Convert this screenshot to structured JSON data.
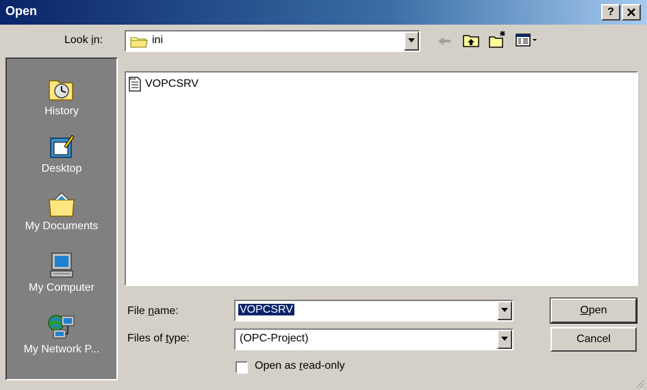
{
  "window": {
    "title": "Open",
    "help_btn": "?",
    "close_btn": "x"
  },
  "lookin": {
    "label_pre": "Look ",
    "label_ul": "i",
    "label_post": "n:",
    "value": "ini",
    "icon": "folder-icon"
  },
  "toolbar": {
    "back_icon": "back-arrow-icon",
    "up_icon": "up-folder-icon",
    "newfolder_icon": "new-folder-icon",
    "views_icon": "views-menu-icon"
  },
  "places": [
    {
      "label": "History",
      "icon": "history-icon"
    },
    {
      "label": "Desktop",
      "icon": "desktop-icon"
    },
    {
      "label": "My Documents",
      "icon": "my-documents-icon"
    },
    {
      "label": "My Computer",
      "icon": "my-computer-icon"
    },
    {
      "label": "My Network P...",
      "icon": "my-network-places-icon"
    }
  ],
  "files": [
    {
      "name": "VOPCSRV",
      "icon": "ini-file-icon"
    }
  ],
  "filename": {
    "label_pre": "File ",
    "label_ul": "n",
    "label_post": "ame:",
    "value": "VOPCSRV"
  },
  "filetype": {
    "label_pre": "Files of ",
    "label_ul": "t",
    "label_post": "ype:",
    "value": "(OPC-Project)"
  },
  "readonly": {
    "label_pre": "Open as ",
    "label_ul": "r",
    "label_post": "ead-only",
    "checked": false
  },
  "buttons": {
    "open_ul": "O",
    "open_post": "pen",
    "cancel": "Cancel"
  },
  "colors": {
    "titlebar_start": "#0a246a",
    "titlebar_end": "#a6caf0",
    "face": "#d4d0c8",
    "places_bg": "#808080",
    "selection": "#0a246a"
  }
}
